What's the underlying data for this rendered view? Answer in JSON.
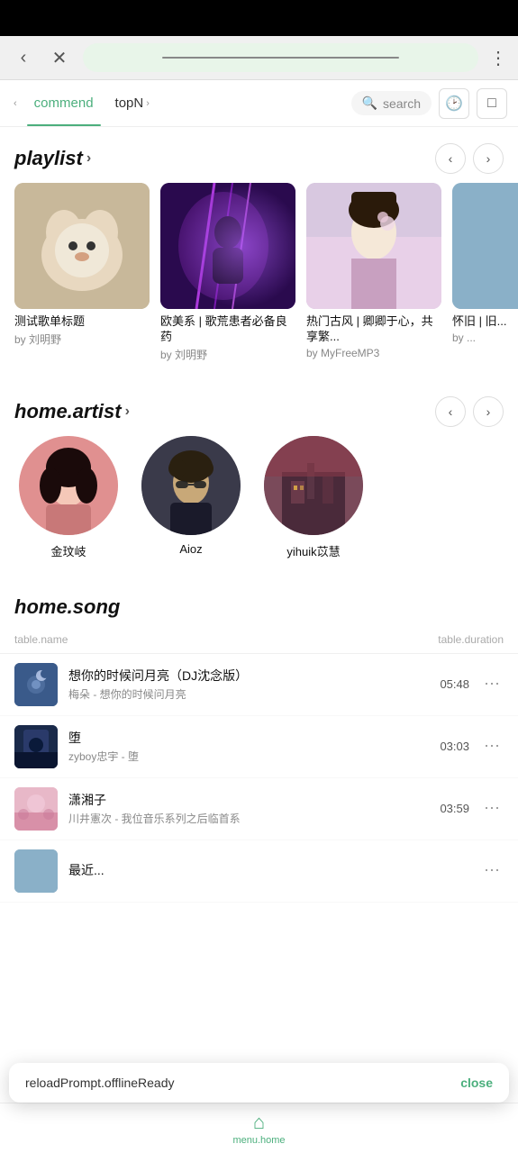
{
  "statusBar": {},
  "browserChrome": {
    "moreIcon": "⋮"
  },
  "tabs": {
    "items": [
      {
        "id": "commend",
        "label": "commend",
        "active": true
      },
      {
        "id": "topN",
        "label": "topN",
        "active": false
      }
    ],
    "search": {
      "label": "search"
    },
    "iconHistory": "🕐",
    "iconLayout": "⊟"
  },
  "playlist": {
    "sectionTitle": "playlist",
    "items": [
      {
        "title": "测试歌单标题",
        "author": "by 刘明野",
        "thumbClass": "thumb-dog"
      },
      {
        "title": "欧美系 | 歌荒患者必备良药",
        "author": "by 刘明野",
        "thumbClass": "thumb-purple"
      },
      {
        "title": "热门古风 | 卿卿于心，共享繁...",
        "author": "by MyFreeMP3",
        "thumbClass": "thumb-lady"
      },
      {
        "title": "怀旧 | 旧...",
        "author": "by ...",
        "thumbClass": "thumb-partial"
      }
    ]
  },
  "artist": {
    "sectionTitle": "home.artist",
    "items": [
      {
        "name": "金玟岐",
        "thumbClass": "artist-pink"
      },
      {
        "name": "Aioz",
        "thumbClass": "artist-dark"
      },
      {
        "name": "yihuik苡慧",
        "thumbClass": "artist-dark2"
      }
    ]
  },
  "song": {
    "sectionTitle": "home.song",
    "tableNameHeader": "table.name",
    "tableDurationHeader": "table.duration",
    "items": [
      {
        "title": "想你的时候问月亮（DJ沈念版）",
        "artist": "梅朵 - 想你的时候问月亮",
        "duration": "05:48",
        "thumbClass": "song-thumb-blue"
      },
      {
        "title": "堕",
        "artist": "zyboy忠宇 - 堕",
        "duration": "03:03",
        "thumbClass": "song-thumb-dark"
      },
      {
        "title": "潇湘子",
        "artist": "川井憲次 - 我位音乐系列之后临首系",
        "duration": "03:59",
        "thumbClass": "song-thumb-pink"
      },
      {
        "title": "最近...",
        "artist": "",
        "duration": "",
        "thumbClass": "song-thumb-partial"
      }
    ]
  },
  "toast": {
    "text": "reloadPrompt.offlineReady",
    "closeLabel": "close"
  },
  "bottomNav": {
    "items": [
      {
        "id": "home",
        "label": "menu.home",
        "icon": "⌂",
        "active": true
      }
    ]
  }
}
